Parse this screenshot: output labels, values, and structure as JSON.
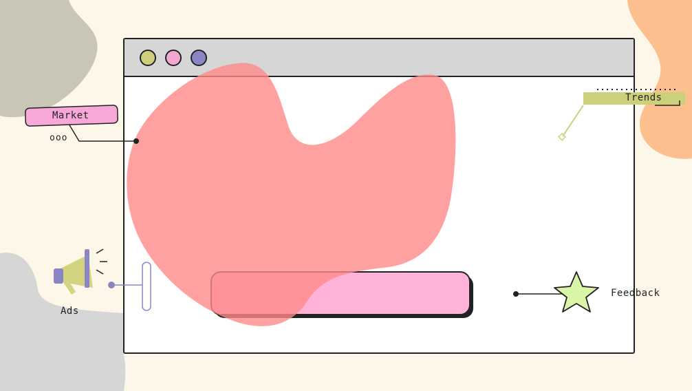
{
  "window": {
    "buttons": [
      {
        "name": "olive",
        "color": "#cfce7c"
      },
      {
        "name": "pink",
        "color": "#f3a6d0"
      },
      {
        "name": "purple",
        "color": "#8a86c4"
      }
    ],
    "search_bar_value": ""
  },
  "callouts": {
    "market": "Market",
    "trends": "Trends",
    "ads": "Ads",
    "feedback": "Feedback",
    "dots": "ooo"
  },
  "colors": {
    "blob": "#ff8a8a",
    "bar_fill": "#ffb3d9",
    "bar_overlap": "#ff7a8a",
    "megaphone": "#d4d480",
    "star": "#d8f5a8",
    "trends_tag": "#cdd07a",
    "market_tag": "#f7a8d8"
  }
}
